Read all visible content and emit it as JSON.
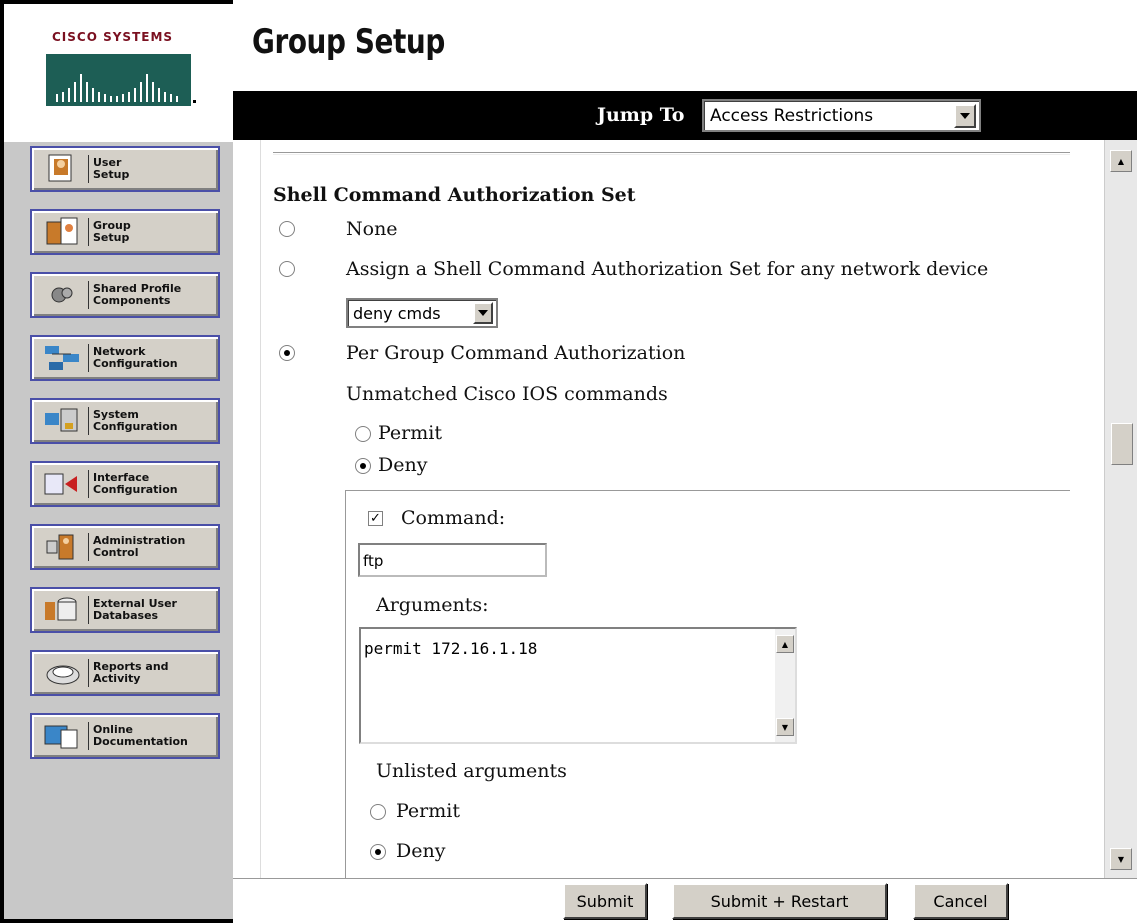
{
  "brand": {
    "logo_text": "Cisco Systems"
  },
  "header": {
    "title": "Group Setup"
  },
  "jump": {
    "label": "Jump To",
    "selected": "Access Restrictions"
  },
  "nav": {
    "items": [
      {
        "label": "User\nSetup",
        "icon": "user-setup-icon"
      },
      {
        "label": "Group\nSetup",
        "icon": "group-setup-icon"
      },
      {
        "label": "Shared Profile\nComponents",
        "icon": "shared-profile-icon"
      },
      {
        "label": "Network\nConfiguration",
        "icon": "network-config-icon"
      },
      {
        "label": "System\nConfiguration",
        "icon": "system-config-icon"
      },
      {
        "label": "Interface\nConfiguration",
        "icon": "interface-config-icon"
      },
      {
        "label": "Administration\nControl",
        "icon": "admin-control-icon"
      },
      {
        "label": "External User\nDatabases",
        "icon": "external-db-icon"
      },
      {
        "label": "Reports and\nActivity",
        "icon": "reports-icon"
      },
      {
        "label": "Online\nDocumentation",
        "icon": "documentation-icon"
      }
    ]
  },
  "form": {
    "section_title": "Shell Command Authorization Set",
    "opt_none": "None",
    "opt_assign": "Assign a Shell Command Authorization Set for any network device",
    "shell_set_value": "deny cmds",
    "opt_per_group": "Per Group Command Authorization",
    "unmatched_label": "Unmatched Cisco IOS commands",
    "permit": "Permit",
    "deny": "Deny",
    "command_label": "Command:",
    "command_value": "ftp",
    "arguments_label": "Arguments:",
    "arguments_value": "permit 172.16.1.18",
    "unlisted_label": "Unlisted arguments",
    "selected_authorization": "Per Group Command Authorization",
    "unmatched_selected": "Deny",
    "unlisted_selected": "Deny",
    "command_checked": true
  },
  "buttons": {
    "submit": "Submit",
    "submit_restart": "Submit + Restart",
    "cancel": "Cancel"
  },
  "colors": {
    "nav_border": "#4a4fa8",
    "logo": "#7a1020",
    "jumpbar": "#000000"
  }
}
